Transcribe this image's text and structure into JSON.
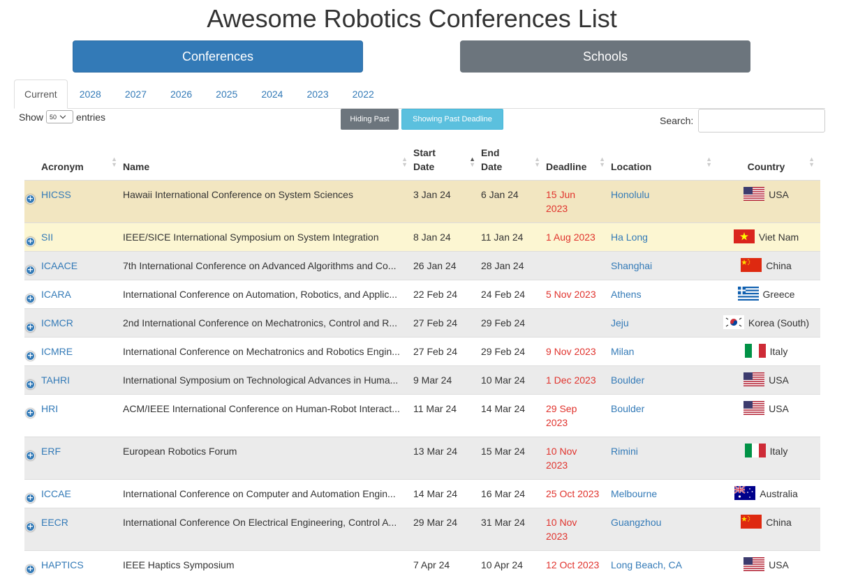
{
  "page": {
    "title": "Awesome Robotics Conferences List"
  },
  "nav": {
    "conferences_label": "Conferences",
    "schools_label": "Schools"
  },
  "tabs": [
    "Current",
    "2028",
    "2027",
    "2026",
    "2025",
    "2024",
    "2023",
    "2022"
  ],
  "controls": {
    "show_label": "Show",
    "entries_value": "50",
    "entries_label": "entries",
    "hiding_past_label": "Hiding Past",
    "showing_past_label": "Showing Past Deadline",
    "search_label": "Search:",
    "search_value": ""
  },
  "table": {
    "headers": {
      "acronym": "Acronym",
      "name": "Name",
      "start_line1": "Start",
      "start_line2": "Date",
      "end_line1": "End",
      "end_line2": "Date",
      "deadline": "Deadline",
      "location": "Location",
      "country": "Country"
    },
    "rows": [
      {
        "acronym": "HICSS",
        "name": "Hawaii International Conference on System Sciences",
        "start": "3 Jan 24",
        "end": "6 Jan 24",
        "deadline_line1": "15 Jun",
        "deadline_line2": "2023",
        "location": "Honolulu",
        "country": "USA",
        "flag": "usa"
      },
      {
        "acronym": "SII",
        "name": "IEEE/SICE International Symposium on System Integration",
        "start": "8 Jan 24",
        "end": "11 Jan 24",
        "deadline_line1": "1 Aug 2023",
        "deadline_line2": "",
        "location": "Ha Long",
        "country": "Viet Nam",
        "flag": "vietnam"
      },
      {
        "acronym": "ICAACE",
        "name": "7th International Conference on Advanced Algorithms and Co...",
        "start": "26 Jan 24",
        "end": "28 Jan 24",
        "deadline_line1": "",
        "deadline_line2": "",
        "location": "Shanghai",
        "country": "China",
        "flag": "china"
      },
      {
        "acronym": "ICARA",
        "name": "International Conference on Automation, Robotics, and Applic...",
        "start": "22 Feb 24",
        "end": "24 Feb 24",
        "deadline_line1": "5 Nov 2023",
        "deadline_line2": "",
        "location": "Athens",
        "country": "Greece",
        "flag": "greece"
      },
      {
        "acronym": "ICMCR",
        "name": "2nd International Conference on Mechatronics, Control and R...",
        "start": "27 Feb 24",
        "end": "29 Feb 24",
        "deadline_line1": "",
        "deadline_line2": "",
        "location": "Jeju",
        "country": "Korea (South)",
        "flag": "korea"
      },
      {
        "acronym": "ICMRE",
        "name": "International Conference on Mechatronics and Robotics Engin...",
        "start": "27 Feb 24",
        "end": "29 Feb 24",
        "deadline_line1": "9 Nov 2023",
        "deadline_line2": "",
        "location": "Milan",
        "country": "Italy",
        "flag": "italy"
      },
      {
        "acronym": "TAHRI",
        "name": "International Symposium on Technological Advances in Huma...",
        "start": "9 Mar 24",
        "end": "10 Mar 24",
        "deadline_line1": "1 Dec 2023",
        "deadline_line2": "",
        "location": "Boulder",
        "country": "USA",
        "flag": "usa"
      },
      {
        "acronym": "HRI",
        "name": "ACM/IEEE International Conference on Human-Robot Interact...",
        "start": "11 Mar 24",
        "end": "14 Mar 24",
        "deadline_line1": "29 Sep",
        "deadline_line2": "2023",
        "location": "Boulder",
        "country": "USA",
        "flag": "usa"
      },
      {
        "acronym": "ERF",
        "name": "European Robotics Forum",
        "start": "13 Mar 24",
        "end": "15 Mar 24",
        "deadline_line1": "10 Nov",
        "deadline_line2": "2023",
        "location": "Rimini",
        "country": "Italy",
        "flag": "italy"
      },
      {
        "acronym": "ICCAE",
        "name": "International Conference on Computer and Automation Engin...",
        "start": "14 Mar 24",
        "end": "16 Mar 24",
        "deadline_line1": "25 Oct 2023",
        "deadline_line2": "",
        "location": "Melbourne",
        "country": "Australia",
        "flag": "australia"
      },
      {
        "acronym": "EECR",
        "name": "International Conference On Electrical Engineering, Control A...",
        "start": "29 Mar 24",
        "end": "31 Mar 24",
        "deadline_line1": "10 Nov",
        "deadline_line2": "2023",
        "location": "Guangzhou",
        "country": "China",
        "flag": "china"
      },
      {
        "acronym": "HAPTICS",
        "name": "IEEE Haptics Symposium",
        "start": "7 Apr 24",
        "end": "10 Apr 24",
        "deadline_line1": "12 Oct 2023",
        "deadline_line2": "",
        "location": "Long Beach, CA",
        "country": "USA",
        "flag": "usa"
      }
    ]
  }
}
